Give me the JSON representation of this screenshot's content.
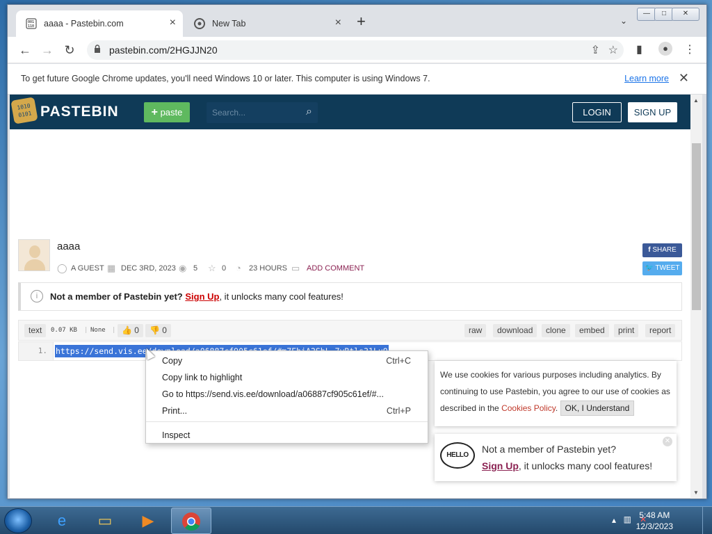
{
  "window": {
    "controls": [
      "—",
      "□",
      "✕"
    ]
  },
  "tabs": [
    {
      "title": "aaaa - Pastebin.com",
      "active": true
    },
    {
      "title": "New Tab",
      "active": false
    }
  ],
  "toolbar": {
    "url": "pastebin.com/2HGJJN20"
  },
  "infobar": {
    "message": "To get future Google Chrome updates, you'll need Windows 10 or later. This computer is using Windows 7.",
    "learn_more": "Learn more"
  },
  "pastebin": {
    "logo_text": "PASTEBIN",
    "logo_badge": "1010 0101",
    "paste_label": "paste",
    "search_placeholder": "Search...",
    "login": "LOGIN",
    "signup": "SIGN UP"
  },
  "paste": {
    "title": "aaaa",
    "author": "A GUEST",
    "date": "DEC 3RD, 2023",
    "views": "5",
    "stars": "0",
    "expires": "23 HOURS",
    "add_comment": "ADD COMMENT",
    "share_fb": "SHARE",
    "share_tw": "TWEET"
  },
  "notice": {
    "bold": "Not a member of Pastebin yet?",
    "link": "Sign Up",
    "rest": ", it unlocks many cool features!"
  },
  "codebar": {
    "syntax": "text",
    "size": "0.07 KB",
    "category": "None",
    "likes": "0",
    "dislikes": "0",
    "actions": [
      "raw",
      "download",
      "clone",
      "embed",
      "print",
      "report"
    ]
  },
  "code": {
    "line_number": "1.",
    "line_text": "https://send.vis.ee/download/a06887cf905c61ef/#m7EhiA2SbL-7yBtls31LuQ"
  },
  "context_menu": {
    "items": [
      {
        "label": "Copy",
        "shortcut": "Ctrl+C"
      },
      {
        "label": "Copy link to highlight",
        "shortcut": ""
      },
      {
        "label": "Go to https://send.vis.ee/download/a06887cf905c61ef/#...",
        "shortcut": ""
      },
      {
        "label": "Print...",
        "shortcut": "Ctrl+P"
      },
      {
        "label": "Inspect",
        "shortcut": ""
      }
    ]
  },
  "cookie": {
    "text_1": "We use cookies for various purposes including analytics. By continuing to use Pastebin, you agree to our use of cookies as described in the ",
    "link": "Cookies Policy",
    "text_2": ". ",
    "button": "OK, I Understand"
  },
  "hello": {
    "bubble": "HELLO",
    "line1": "Not a member of Pastebin yet?",
    "link": "Sign Up",
    "line2_rest": ", it unlocks many cool features!"
  },
  "taskbar": {
    "time": "5:48 AM",
    "date": "12/3/2023"
  },
  "colors": {
    "pastebin_header": "#0f3a57",
    "paste_button": "#5fb95f",
    "selection": "#3a74d8",
    "link_red": "#c00000"
  }
}
